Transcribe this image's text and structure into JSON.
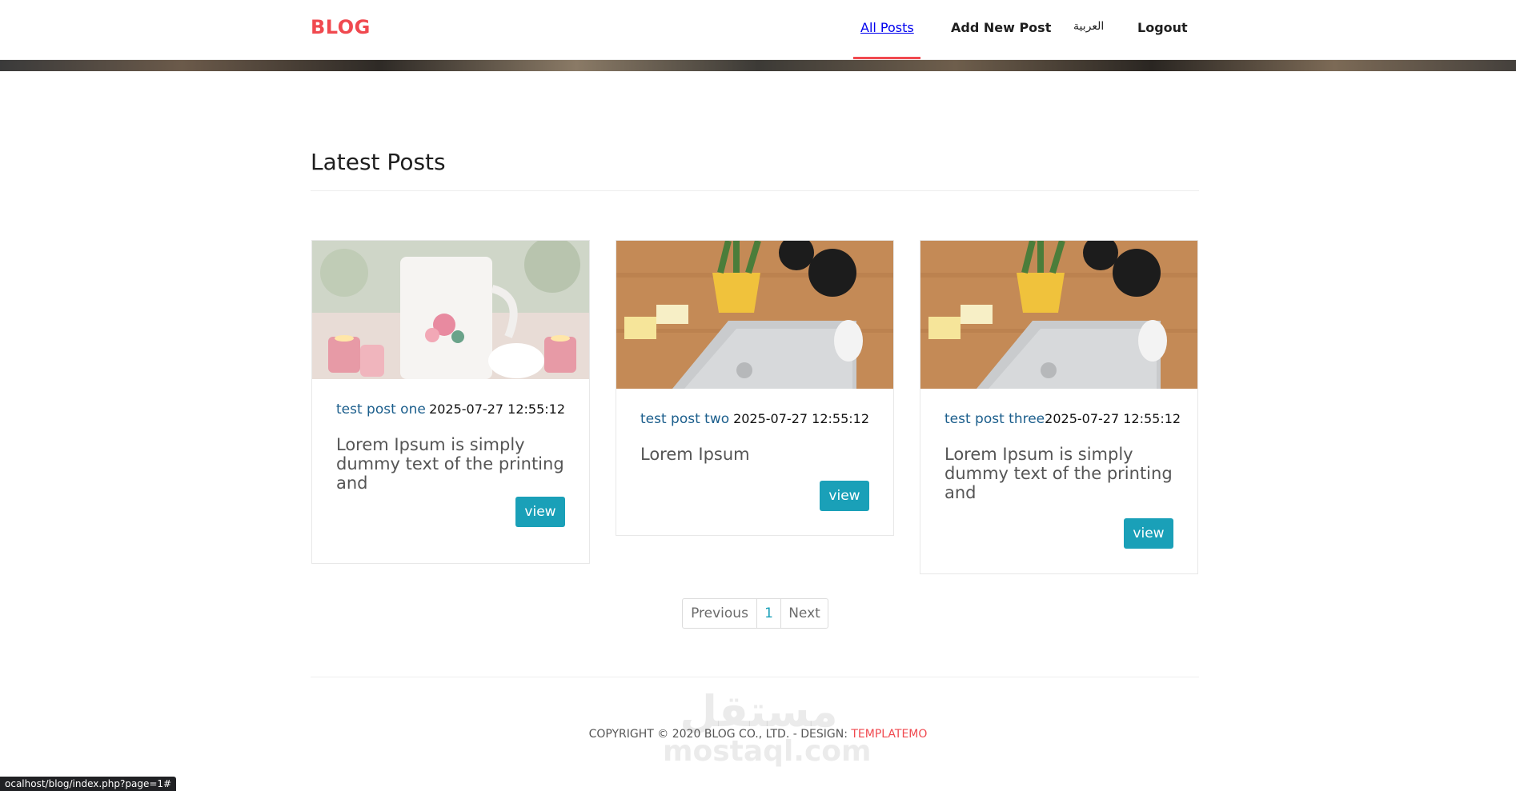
{
  "brand": {
    "logo": "BLOG",
    "accent_color": "#f0494f"
  },
  "nav": {
    "items": [
      {
        "label": "All Posts",
        "active": true
      },
      {
        "label": "Add New Post",
        "active": false
      },
      {
        "label": "العربية",
        "active": false
      },
      {
        "label": "Logout",
        "active": false
      }
    ]
  },
  "main": {
    "section_title": "Latest Posts",
    "posts": [
      {
        "title": "test post one",
        "date": "2025-07-27 12:55:12",
        "excerpt": "Lorem Ipsum is simply dummy text of the printing and",
        "button_label": "view",
        "image": "mug-bride-photo"
      },
      {
        "title": "test post two",
        "date": "2025-07-27 12:55:12",
        "excerpt": "Lorem Ipsum",
        "button_label": "view",
        "image": "laptop-desk-photo"
      },
      {
        "title": "test post three",
        "date": "2025-07-27 12:55:12",
        "excerpt": "Lorem Ipsum is simply dummy text of the printing and",
        "button_label": "view",
        "image": "laptop-desk-photo"
      }
    ]
  },
  "pagination": {
    "previous": "Previous",
    "current": "1",
    "next": "Next"
  },
  "footer": {
    "copyright": "COPYRIGHT © 2020 BLOG CO., LTD. - DESIGN:",
    "design_link": "TEMPLATEMO"
  },
  "watermark": {
    "arabic": "مستقل",
    "latin": "mostaql.com"
  },
  "status_bar": {
    "url": "ocalhost/blog/index.php?page=1#"
  },
  "colors": {
    "button": "#1aa0b8",
    "post_title": "#1b5e8c"
  }
}
